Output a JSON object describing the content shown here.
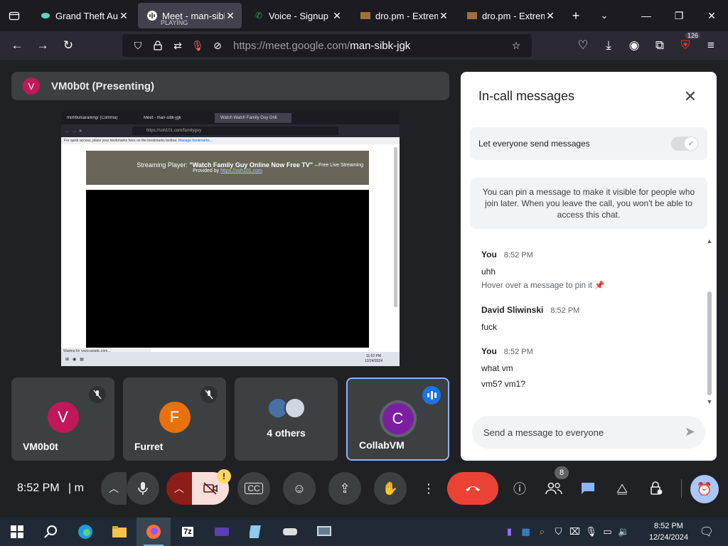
{
  "browser": {
    "tabs": [
      {
        "title": "Grand Theft Aut",
        "active": false,
        "icon": "game-icon"
      },
      {
        "title": "Meet - man-sibk",
        "sub": "PLAYING",
        "active": true,
        "icon": "meet-icon"
      },
      {
        "title": "Voice - Signup",
        "active": false,
        "icon": "phone-icon"
      },
      {
        "title": "dro.pm - Extrem",
        "active": false,
        "icon": "file-icon"
      },
      {
        "title": "dro.pm - Extrem",
        "active": false,
        "icon": "file-icon"
      }
    ],
    "url_host": "https://meet.google.com/",
    "url_path": "man-sibk-jgk",
    "extensions_badge": "126"
  },
  "meet": {
    "presenter": {
      "initial": "V",
      "label": "VM0b0t (Presenting)"
    },
    "shared_screen": {
      "tabs": [
        "mof/bulsara/eng/ (Comma)",
        "Meet - man-sibk-jgk",
        "Watch Watch Family Guy Onli"
      ],
      "url": "https://ssh101.com/familyguy",
      "bookmarks_text": "For quick access, place your bookmarks here on the bookmarks toolbar.",
      "bookmarks_link": "Manage bookmarks...",
      "player_prefix": "Streaming Player:",
      "player_title": "\"Watch Family Guy Online Now Free TV\"",
      "player_dash": "–",
      "player_free": "Free Live Streaming",
      "provided_by": "Provided by",
      "provided_link": "https://ssh101.com",
      "status": "Waiting for www.gstatic.com...",
      "clock_time": "11:52 PM",
      "clock_date": "12/24/2024"
    },
    "tiles": [
      {
        "name": "VM0b0t",
        "initial": "V",
        "color": "#c2185b",
        "muted": true
      },
      {
        "name": "Furret",
        "initial": "F",
        "color": "#e8710a",
        "muted": true
      },
      {
        "name": "4 others",
        "is_group": true
      },
      {
        "name": "CollabVM",
        "initial": "C",
        "color": "#7b1fa2",
        "speaking": true
      }
    ]
  },
  "chat": {
    "title": "In-call messages",
    "permission_label": "Let everyone send messages",
    "info": "You can pin a message to make it visible for people who join later. When you leave the call, you won't be able to access this chat.",
    "messages": [
      {
        "author": "You",
        "time": "8:52 PM",
        "lines": [
          "uhh"
        ],
        "hint": "Hover over a message to pin it"
      },
      {
        "author": "David Sliwinski",
        "time": "8:52 PM",
        "lines": [
          "fuck"
        ]
      },
      {
        "author": "You",
        "time": "8:52 PM",
        "lines": [
          "what vm",
          "vm5? vm1?"
        ]
      }
    ],
    "input_placeholder": "Send a message to everyone"
  },
  "controls": {
    "time": "8:52 PM",
    "separator": "| m",
    "participants_count": "8",
    "warning": "!"
  },
  "taskbar": {
    "time": "8:52 PM",
    "date": "12/24/2024"
  }
}
